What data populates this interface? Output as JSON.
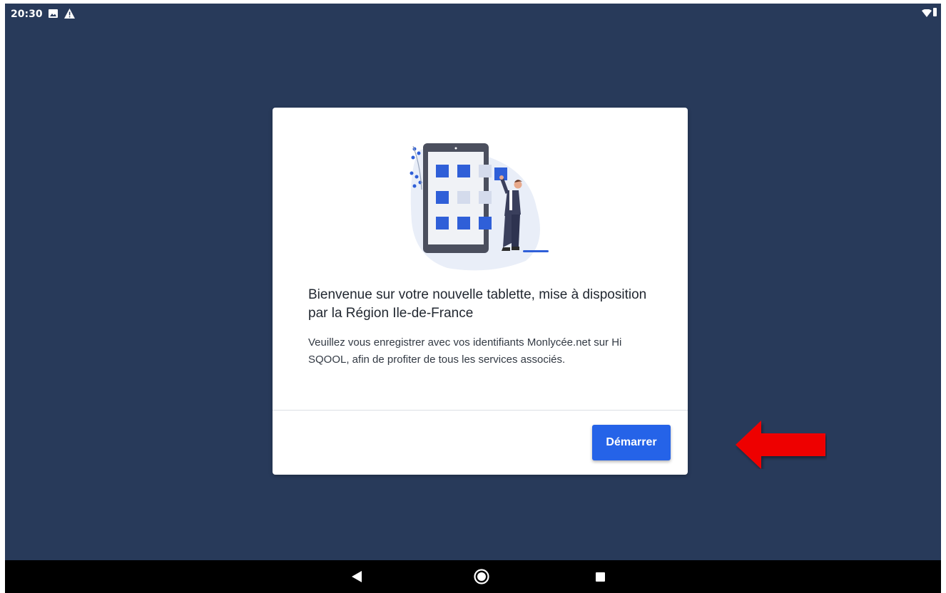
{
  "status_bar": {
    "time": "20:30",
    "icons": [
      "image-icon",
      "warning-icon",
      "wifi-icon",
      "battery-icon"
    ]
  },
  "dialog": {
    "illustration": "tablet-apps-illustration",
    "title": "Bienvenue sur votre nouvelle tablette, mise à disposition par la Région Ile-de-France",
    "body": "Veuillez vous enregistrer avec vos identifiants Monlycée.net sur Hi SQOOL, afin de profiter de tous les services associés.",
    "start_label": "Démarrer"
  },
  "annotation": {
    "icon": "red-arrow-icon"
  },
  "nav_bar": {
    "icons": [
      "back-icon",
      "home-icon",
      "recents-icon"
    ]
  },
  "colors": {
    "background": "#283a5a",
    "accent": "#2563e8",
    "arrow": "#ee0000",
    "nav_bar": "#000000"
  }
}
